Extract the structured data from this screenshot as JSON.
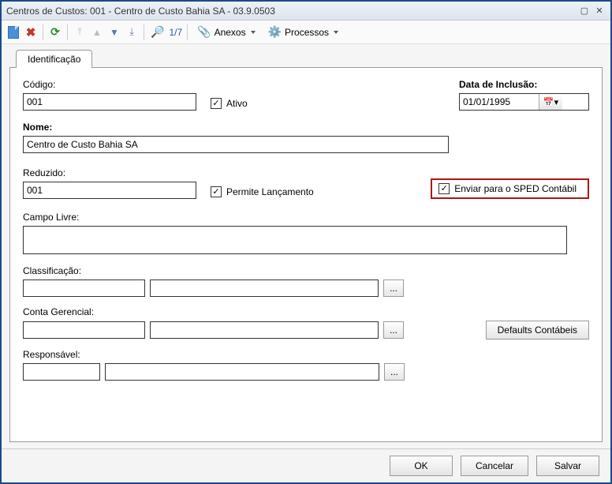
{
  "window": {
    "title": "Centros de Custos: 001 - Centro de Custo Bahia SA - 03.9.0503"
  },
  "toolbar": {
    "record_position": "1/7",
    "anexos_label": "Anexos",
    "processos_label": "Processos"
  },
  "tabs": {
    "identificacao": "Identificação"
  },
  "labels": {
    "codigo": "Código:",
    "ativo": "Ativo",
    "data_inclusao": "Data de Inclusão:",
    "nome": "Nome:",
    "reduzido": "Reduzido:",
    "permite_lancamento": "Permite Lançamento",
    "enviar_sped": "Enviar para o SPED Contábil",
    "campo_livre": "Campo Livre:",
    "classificacao": "Classificação:",
    "conta_gerencial": "Conta Gerencial:",
    "responsavel": "Responsável:",
    "defaults_contabeis": "Defaults Contábeis"
  },
  "values": {
    "codigo": "001",
    "data_inclusao": "01/01/1995",
    "nome": "Centro de Custo Bahia SA",
    "reduzido": "001",
    "campo_livre": "",
    "classificacao_code": "",
    "classificacao_desc": "",
    "conta_gerencial_code": "",
    "conta_gerencial_desc": "",
    "responsavel_code": "",
    "responsavel_desc": ""
  },
  "checks": {
    "ativo": "✓",
    "permite_lancamento": "✓",
    "enviar_sped": "✓"
  },
  "footer": {
    "ok": "OK",
    "cancelar": "Cancelar",
    "salvar": "Salvar"
  }
}
